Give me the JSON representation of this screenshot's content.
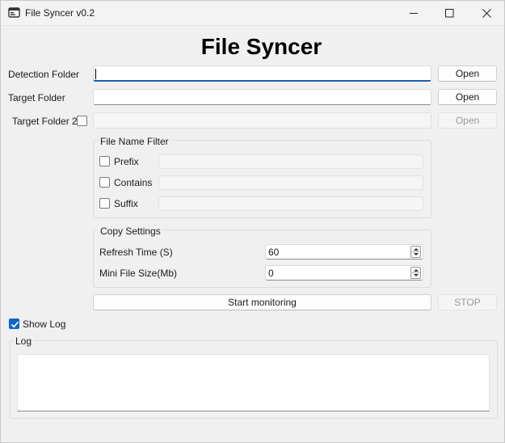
{
  "window": {
    "title": "File Syncer v0.2",
    "heading": "File Syncer"
  },
  "icons": {
    "app": "app-window-icon",
    "minimize": "minimize-icon",
    "maximize": "maximize-icon",
    "close": "close-icon",
    "check": "checkmark-icon"
  },
  "folders": {
    "detection_label": "Detection Folder",
    "detection_value": "",
    "target_label": "Target Folder",
    "target_value": "",
    "target2_label": "Target Folder 2",
    "target2_checked": false,
    "target2_value": "",
    "open_label": "Open"
  },
  "filter": {
    "title": "File Name Filter",
    "prefix_label": "Prefix",
    "contains_label": "Contains",
    "suffix_label": "Suffix",
    "prefix_checked": false,
    "contains_checked": false,
    "suffix_checked": false
  },
  "copy_settings": {
    "title": "Copy Settings",
    "refresh_label": "Refresh Time (S)",
    "refresh_value": "60",
    "min_size_label": "Mini File Size(Mb)",
    "min_size_value": "0"
  },
  "actions": {
    "start_label": "Start monitoring",
    "stop_label": "STOP"
  },
  "log": {
    "show_log_label": "Show Log",
    "show_log_checked": true,
    "title": "Log",
    "content": ""
  },
  "colors": {
    "accent": "#0f66c6",
    "focus_underline": "#1a5fb4"
  }
}
